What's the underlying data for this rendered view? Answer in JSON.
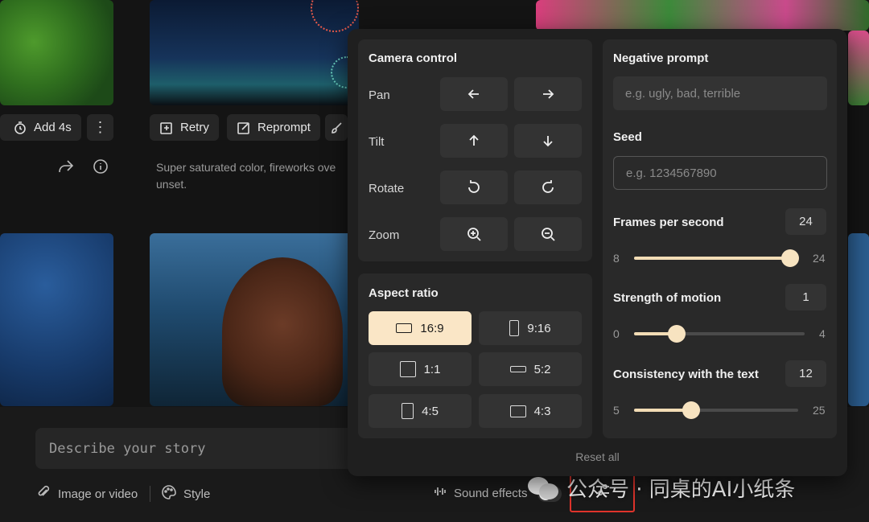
{
  "gallery": {
    "row1": {
      "add_label": "Add 4s",
      "retry_label": "Retry",
      "reprompt_label": "Reprompt",
      "caption": "Super saturated color, fireworks ove unset."
    }
  },
  "composer": {
    "placeholder": "Describe your story",
    "image_label": "Image or video",
    "style_label": "Style",
    "sound_label": "Sound effects"
  },
  "settings": {
    "camera": {
      "title": "Camera control",
      "rows": [
        {
          "label": "Pan",
          "buttons": [
            "arrow-left-icon",
            "arrow-right-icon"
          ]
        },
        {
          "label": "Tilt",
          "buttons": [
            "arrow-up-icon",
            "arrow-down-icon"
          ]
        },
        {
          "label": "Rotate",
          "buttons": [
            "rotate-ccw-icon",
            "rotate-cw-icon"
          ]
        },
        {
          "label": "Zoom",
          "buttons": [
            "zoom-in-icon",
            "zoom-out-icon"
          ]
        }
      ]
    },
    "aspect": {
      "title": "Aspect ratio",
      "selected": "16:9",
      "options": [
        "16:9",
        "9:16",
        "1:1",
        "5:2",
        "4:5",
        "4:3"
      ]
    },
    "negative": {
      "title": "Negative prompt",
      "placeholder": "e.g. ugly, bad, terrible"
    },
    "seed": {
      "title": "Seed",
      "placeholder": "e.g. 1234567890"
    },
    "fps": {
      "title": "Frames per second",
      "value": "24",
      "min": "8",
      "max": "24",
      "fraction": 1.0
    },
    "motion": {
      "title": "Strength of motion",
      "value": "1",
      "min": "0",
      "max": "4",
      "fraction": 0.25
    },
    "consistency": {
      "title": "Consistency with the text",
      "value": "12",
      "min": "5",
      "max": "25",
      "fraction": 0.35
    },
    "reset_label": "Reset all"
  },
  "watermark": {
    "text": "公众号 · 同桌的AI小纸条"
  },
  "colors": {
    "accent": "#fae6c6",
    "highlight_box": "#e0342c"
  }
}
